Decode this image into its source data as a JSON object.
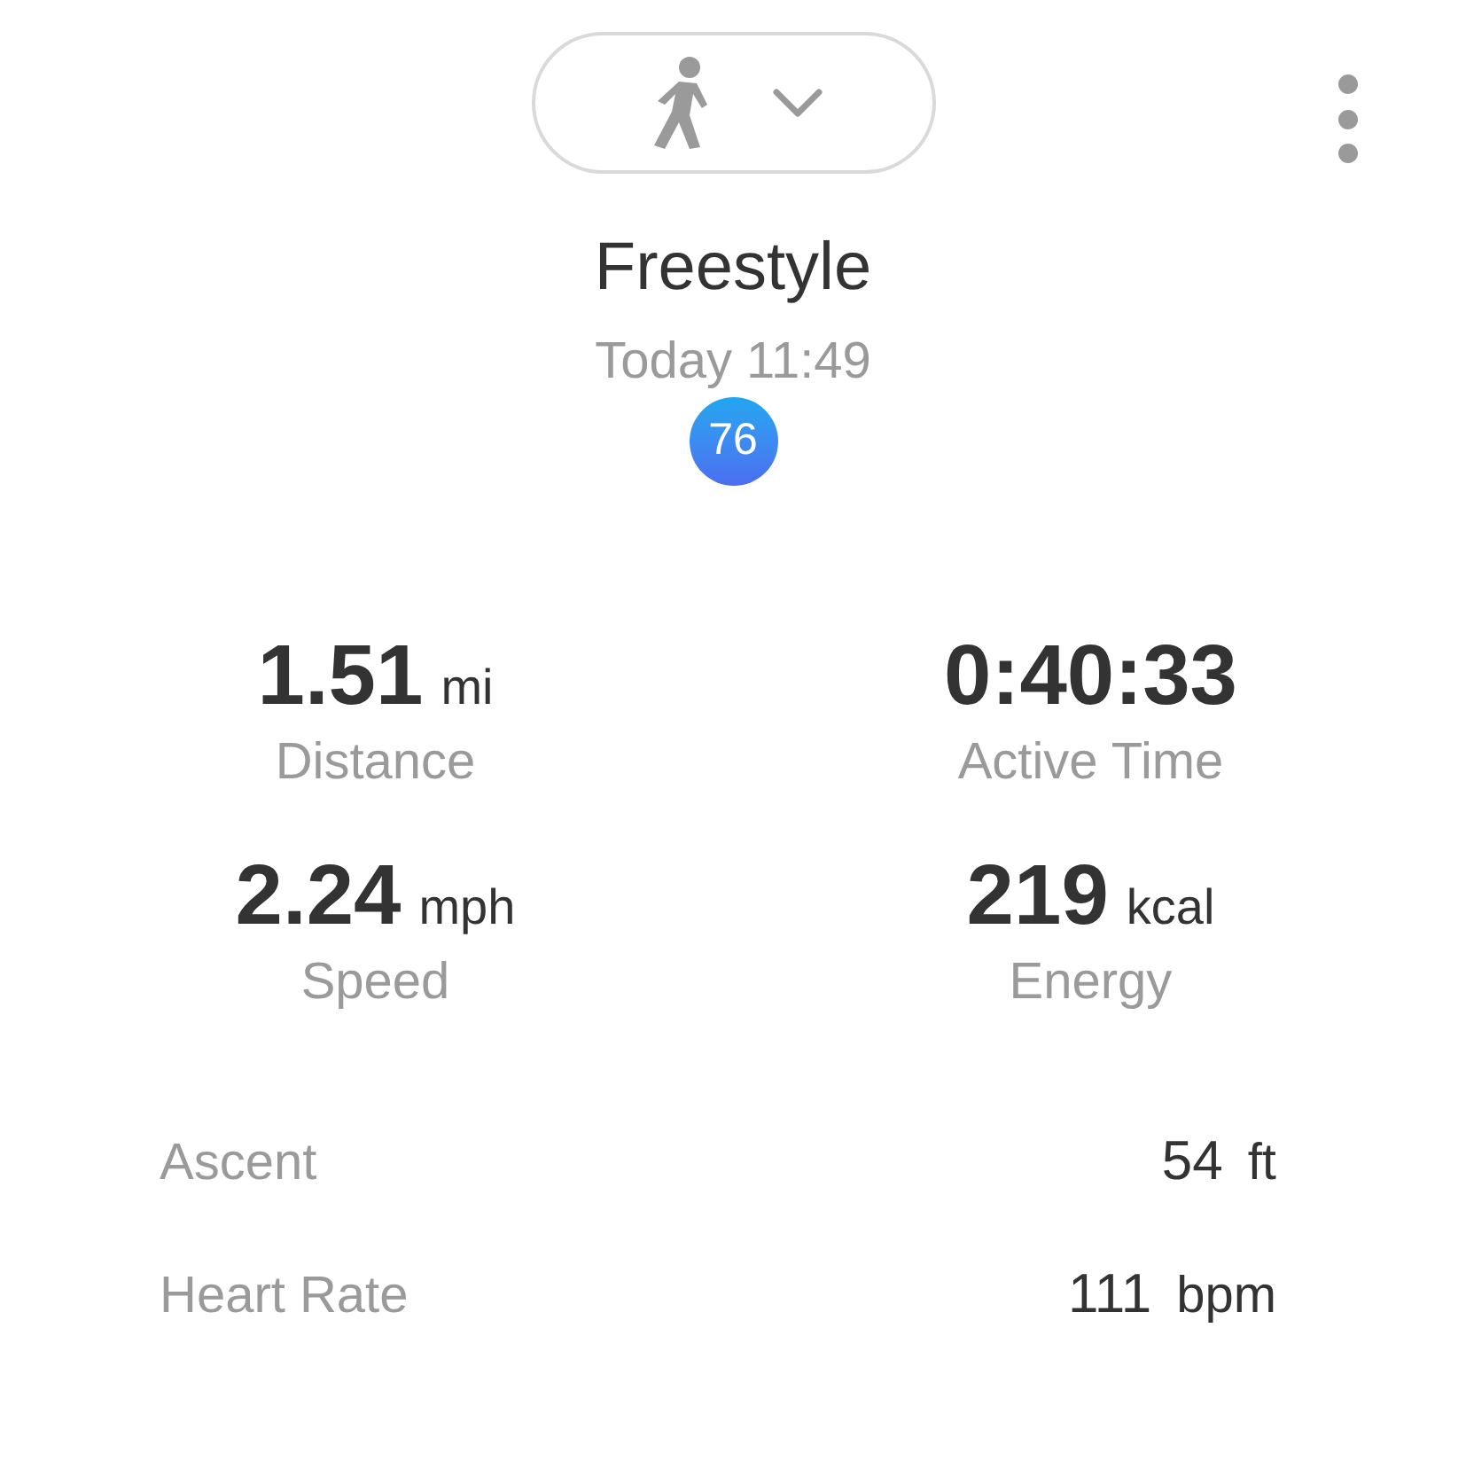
{
  "title": "Freestyle",
  "time": "Today 11:49",
  "badge": "76",
  "stats": [
    {
      "value": "1.51",
      "unit": "mi",
      "label": "Distance"
    },
    {
      "value": "0:40:33",
      "label": "Active Time"
    },
    {
      "value": "2.24",
      "unit": "mph",
      "label": "Speed"
    },
    {
      "value": "219",
      "unit": "kcal",
      "label": "Energy"
    }
  ],
  "details": [
    {
      "label": "Ascent",
      "value": "54",
      "unit": "ft"
    },
    {
      "label": "Heart Rate",
      "value": "111",
      "unit": "bpm"
    }
  ]
}
